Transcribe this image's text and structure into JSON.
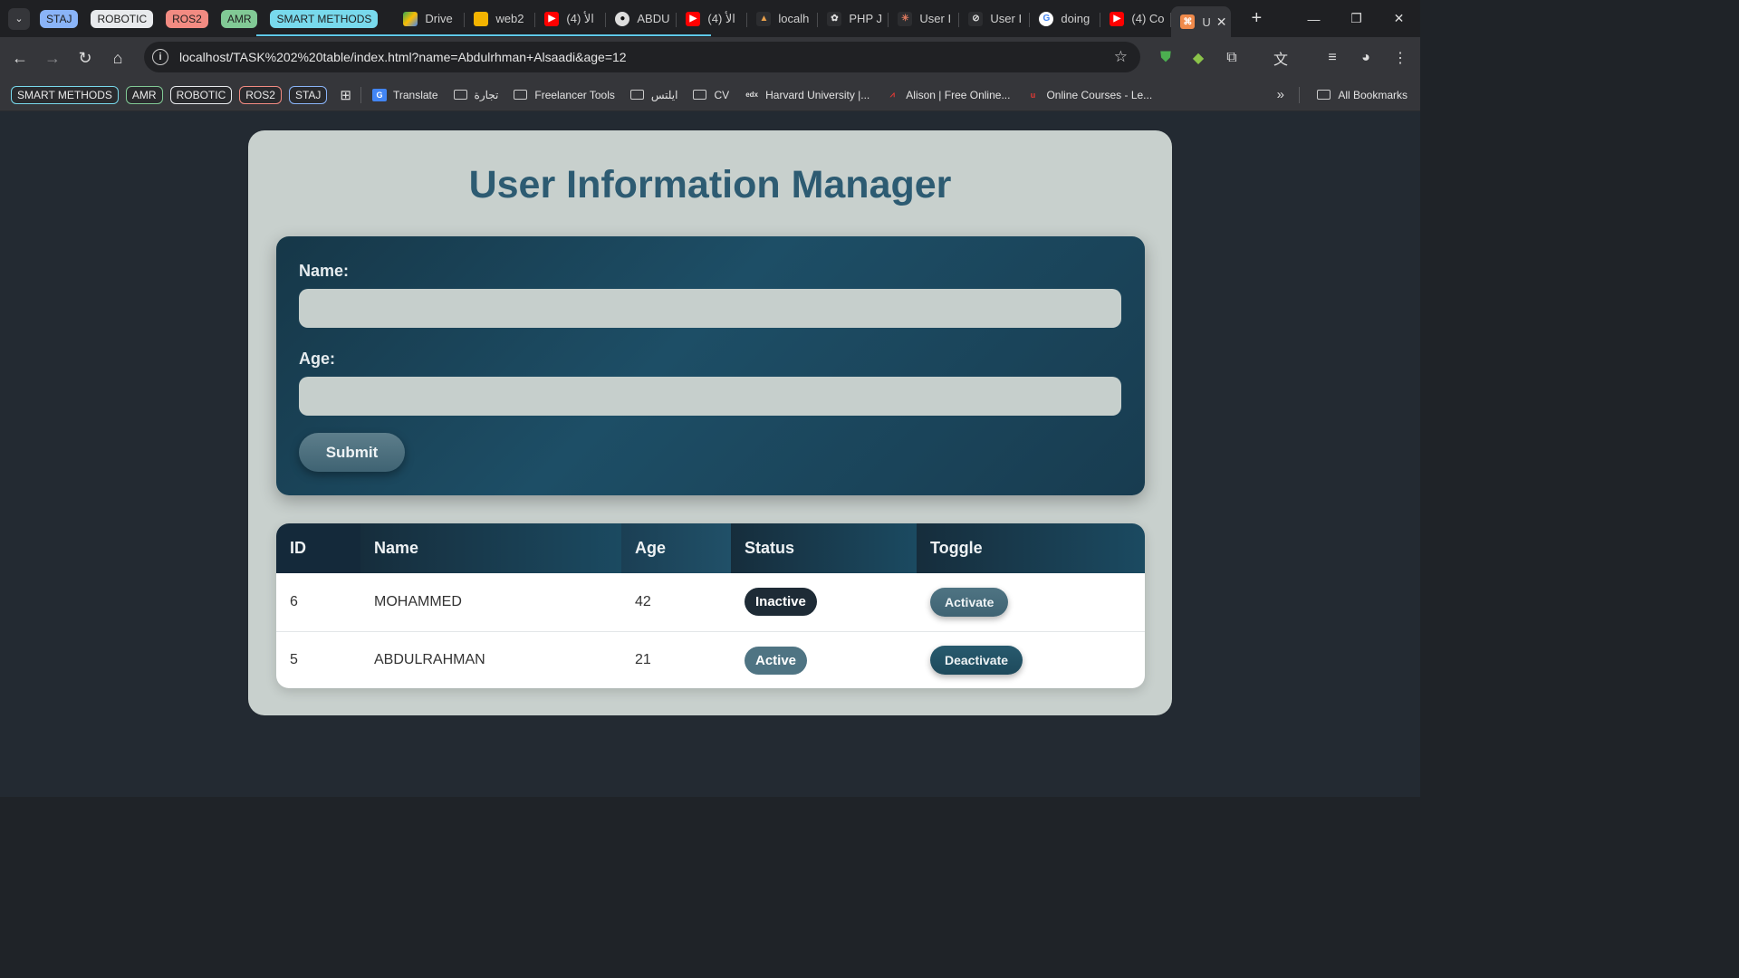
{
  "browser": {
    "tab_groups": [
      {
        "label": "STAJ",
        "color": "#8ab4f8"
      },
      {
        "label": "ROBOTIC",
        "color": "#e8eaed"
      },
      {
        "label": "ROS2",
        "color": "#f28b82"
      },
      {
        "label": "AMR",
        "color": "#81c995"
      },
      {
        "label": "SMART METHODS",
        "color": "#78d9ec"
      }
    ],
    "tabs": [
      {
        "title": "Drive",
        "icon": "drive-icon"
      },
      {
        "title": "web2",
        "icon": "slides-icon"
      },
      {
        "title": "(4) الأ",
        "icon": "youtube-icon"
      },
      {
        "title": "ABDU",
        "icon": "github-icon"
      },
      {
        "title": "(4) الأ",
        "icon": "youtube-icon"
      },
      {
        "title": "localh",
        "icon": "xampp-icon"
      },
      {
        "title": "PHP J",
        "icon": "openai-icon"
      },
      {
        "title": "User I",
        "icon": "claude-icon"
      },
      {
        "title": "User I",
        "icon": "cursor-icon"
      },
      {
        "title": "doing",
        "icon": "google-icon"
      },
      {
        "title": "(4) Co",
        "icon": "youtube-icon"
      }
    ],
    "active_tab": {
      "title": "U",
      "icon": "xampp-icon"
    },
    "url": "localhost/TASK%202%20table/index.html?name=Abdulrhman+Alsaadi&age=12",
    "bookmarks": {
      "groups": [
        {
          "label": "SMART METHODS",
          "color": "#78d9ec"
        },
        {
          "label": "AMR",
          "color": "#81c995"
        },
        {
          "label": "ROBOTIC",
          "color": "#e8eaed"
        },
        {
          "label": "ROS2",
          "color": "#f28b82"
        },
        {
          "label": "STAJ",
          "color": "#8ab4f8"
        }
      ],
      "items": [
        {
          "label": "Translate",
          "type": "translate-icon"
        },
        {
          "label": "تجارة",
          "type": "folder-icon"
        },
        {
          "label": "Freelancer Tools",
          "type": "folder-icon"
        },
        {
          "label": "ايلتس",
          "type": "folder-icon"
        },
        {
          "label": "CV",
          "type": "folder-icon"
        },
        {
          "label": "Harvard University |...",
          "type": "edx-icon"
        },
        {
          "label": "Alison | Free Online...",
          "type": "alison-icon"
        },
        {
          "label": "Online Courses - Le...",
          "type": "udemy-icon"
        }
      ],
      "all_bookmarks": "All Bookmarks"
    }
  },
  "page": {
    "title": "User Information Manager",
    "form": {
      "name_label": "Name:",
      "name_value": "",
      "age_label": "Age:",
      "age_value": "",
      "submit_label": "Submit"
    },
    "table": {
      "headers": [
        "ID",
        "Name",
        "Age",
        "Status",
        "Toggle"
      ],
      "rows": [
        {
          "id": "6",
          "name": "MOHAMMED",
          "age": "42",
          "status": "Inactive",
          "toggle": "Activate"
        },
        {
          "id": "5",
          "name": "ABDULRAHMAN",
          "age": "21",
          "status": "Active",
          "toggle": "Deactivate"
        }
      ]
    },
    "colors": {
      "accent": "#2d5b72",
      "inactive_badge": "#1e2b36",
      "active_badge": "#4f7483",
      "activate_button": "#3f6373",
      "deactivate_button": "#1e4a5c"
    }
  }
}
